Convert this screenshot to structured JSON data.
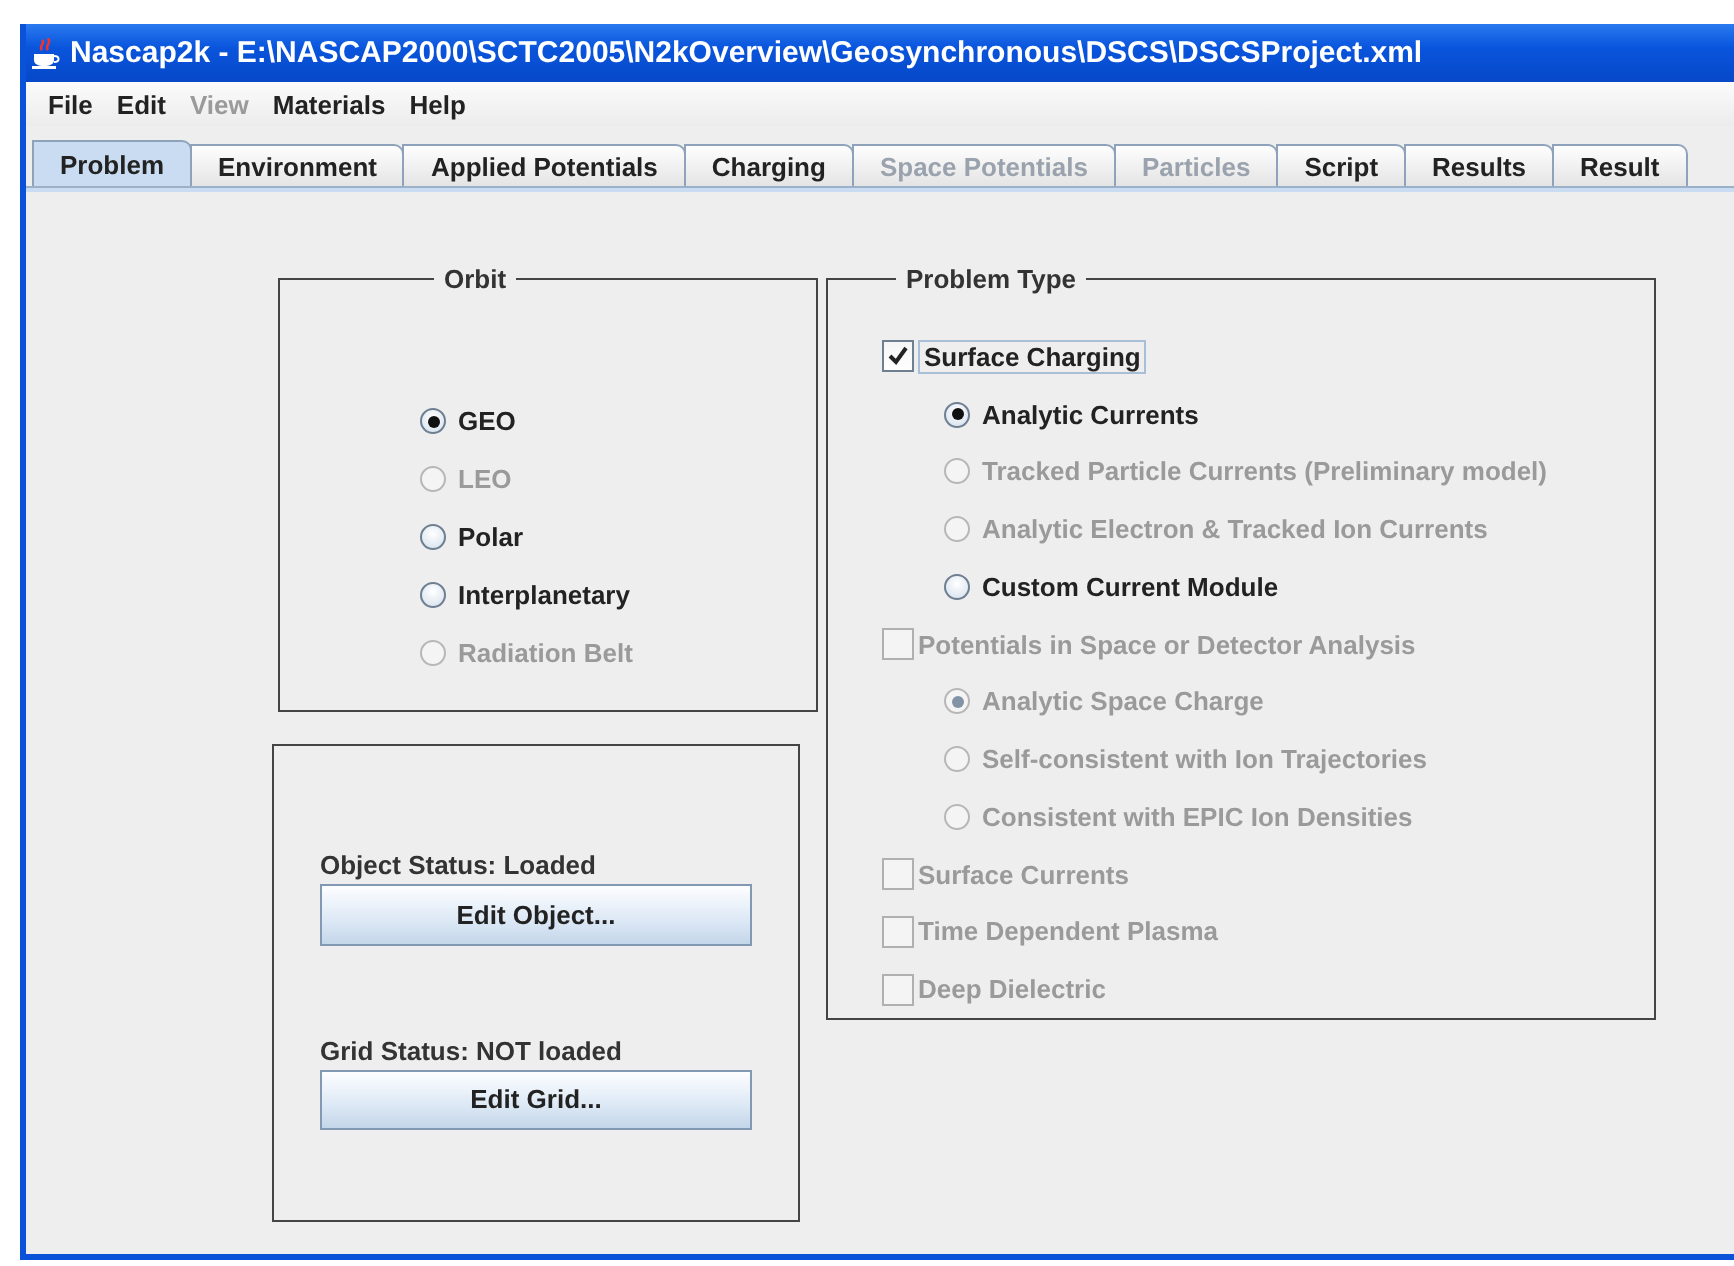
{
  "window": {
    "title": "Nascap2k - E:\\NASCAP2000\\SCTC2005\\N2kOverview\\Geosynchronous\\DSCS\\DSCSProject.xml"
  },
  "menu": [
    {
      "label": "File",
      "disabled": false
    },
    {
      "label": "Edit",
      "disabled": false
    },
    {
      "label": "View",
      "disabled": true
    },
    {
      "label": "Materials",
      "disabled": false
    },
    {
      "label": "Help",
      "disabled": false
    }
  ],
  "tabs": [
    {
      "label": "Problem",
      "selected": true,
      "disabled": false
    },
    {
      "label": "Environment",
      "selected": false,
      "disabled": false
    },
    {
      "label": "Applied Potentials",
      "selected": false,
      "disabled": false
    },
    {
      "label": "Charging",
      "selected": false,
      "disabled": false
    },
    {
      "label": "Space Potentials",
      "selected": false,
      "disabled": true
    },
    {
      "label": "Particles",
      "selected": false,
      "disabled": true
    },
    {
      "label": "Script",
      "selected": false,
      "disabled": false
    },
    {
      "label": "Results",
      "selected": false,
      "disabled": false
    },
    {
      "label": "Result",
      "selected": false,
      "disabled": false
    }
  ],
  "orbit": {
    "title": "Orbit",
    "options": [
      {
        "label": "GEO",
        "selected": true,
        "disabled": false
      },
      {
        "label": "LEO",
        "selected": false,
        "disabled": true
      },
      {
        "label": "Polar",
        "selected": false,
        "disabled": false
      },
      {
        "label": "Interplanetary",
        "selected": false,
        "disabled": false
      },
      {
        "label": "Radiation Belt",
        "selected": false,
        "disabled": true
      }
    ]
  },
  "model": {
    "items": [
      {
        "status": "Object Status: Loaded",
        "button": "Edit Object..."
      },
      {
        "status": "Grid Status: NOT loaded",
        "button": "Edit Grid..."
      }
    ]
  },
  "problem_type": {
    "title": "Problem Type",
    "options": [
      {
        "kind": "checkbox",
        "label": "Surface Charging",
        "checked": true,
        "disabled": false,
        "children": [
          {
            "kind": "radio",
            "label": "Analytic Currents",
            "selected": true,
            "disabled": false
          },
          {
            "kind": "radio",
            "label": "Tracked Particle Currents (Preliminary model)",
            "selected": false,
            "disabled": true
          },
          {
            "kind": "radio",
            "label": "Analytic Electron & Tracked Ion Currents",
            "selected": false,
            "disabled": true
          },
          {
            "kind": "radio",
            "label": "Custom Current Module",
            "selected": false,
            "disabled": false
          }
        ]
      },
      {
        "kind": "checkbox",
        "label": "Potentials in Space or Detector Analysis",
        "checked": false,
        "disabled": true,
        "children": [
          {
            "kind": "radio",
            "label": "Analytic Space Charge",
            "selected": true,
            "disabled": true
          },
          {
            "kind": "radio",
            "label": "Self-consistent with Ion Trajectories",
            "selected": false,
            "disabled": true
          },
          {
            "kind": "radio",
            "label": "Consistent with EPIC Ion Densities",
            "selected": false,
            "disabled": true
          }
        ]
      },
      {
        "kind": "checkbox",
        "label": "Surface Currents",
        "checked": false,
        "disabled": true
      },
      {
        "kind": "checkbox",
        "label": "Time Dependent Plasma",
        "checked": false,
        "disabled": true
      },
      {
        "kind": "checkbox",
        "label": "Deep Dielectric",
        "checked": false,
        "disabled": true
      }
    ]
  }
}
